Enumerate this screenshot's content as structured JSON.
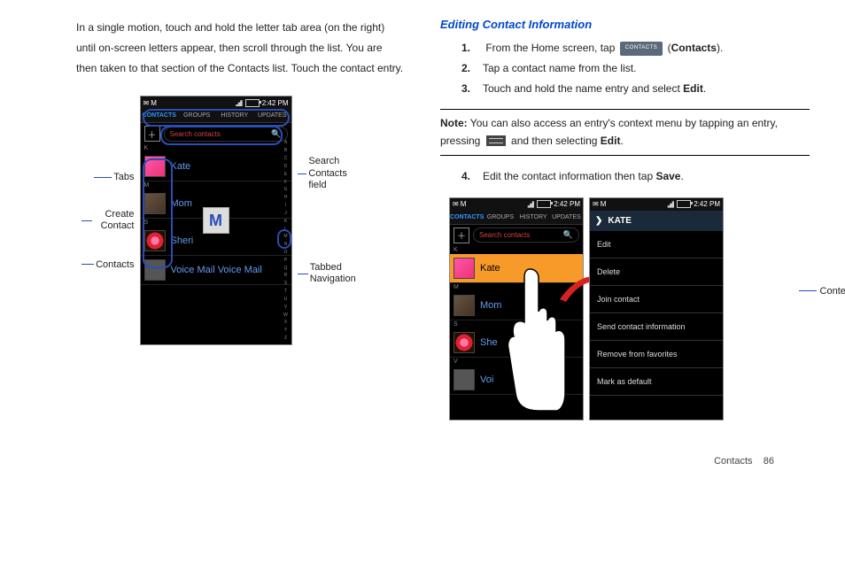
{
  "intro": "In a single motion, touch and hold the letter tab area (on the right) until on-screen letters appear, then scroll through the list. You are then taken to that section of the Contacts list. Touch the contact entry.",
  "section_title": "Editing Contact Information",
  "steps": {
    "s1_pre": "From the Home screen, tap ",
    "s1_chip": "CONTACTS",
    "s1_post_open": " (",
    "s1_bold": "Contacts",
    "s1_post_close": ").",
    "s2": "Tap a contact name from the list.",
    "s3_pre": "Touch and hold the name entry and select ",
    "s3_bold": "Edit",
    "s3_post": ".",
    "s4_pre": "Edit the contact information then tap ",
    "s4_bold": "Save",
    "s4_post": "."
  },
  "note": {
    "label": "Note:",
    "pre": " You can also access an entry's context menu by tapping an entry, pressing ",
    "mid": " and then selecting ",
    "bold": "Edit",
    "post": "."
  },
  "phone": {
    "time": "2:42 PM",
    "tabs": {
      "contacts": "CONTACTS",
      "groups": "GROUPS",
      "history": "HISTORY",
      "updates": "UPDATES"
    },
    "search_placeholder": "Search contacts",
    "letters": [
      "A",
      "B",
      "C",
      "D",
      "E",
      "F",
      "G",
      "H",
      "I",
      "J",
      "K",
      "L",
      "M",
      "N",
      "O",
      "P",
      "Q",
      "R",
      "S",
      "T",
      "U",
      "V",
      "W",
      "X",
      "Y",
      "Z"
    ],
    "big_letter": "M",
    "section_k": "K",
    "section_m": "M",
    "section_s": "S",
    "section_v": "V",
    "c_kate": "Kate",
    "c_mom": "Mom",
    "c_sheri": "Sheri",
    "c_she": "She",
    "c_voice": "Voice Mail Voice Mail"
  },
  "context": {
    "title": "KATE",
    "items": [
      "Edit",
      "Delete",
      "Join contact",
      "Send contact information",
      "Remove from favorites",
      "Mark as default"
    ]
  },
  "labels": {
    "tabs": "Tabs",
    "create": "Create Contact",
    "contacts": "Contacts",
    "search": "Search Contacts field",
    "tabnav": "Tabbed Navigation",
    "ctxmenu": "Context Menu"
  },
  "footer": {
    "section": "Contacts",
    "page": "86"
  }
}
